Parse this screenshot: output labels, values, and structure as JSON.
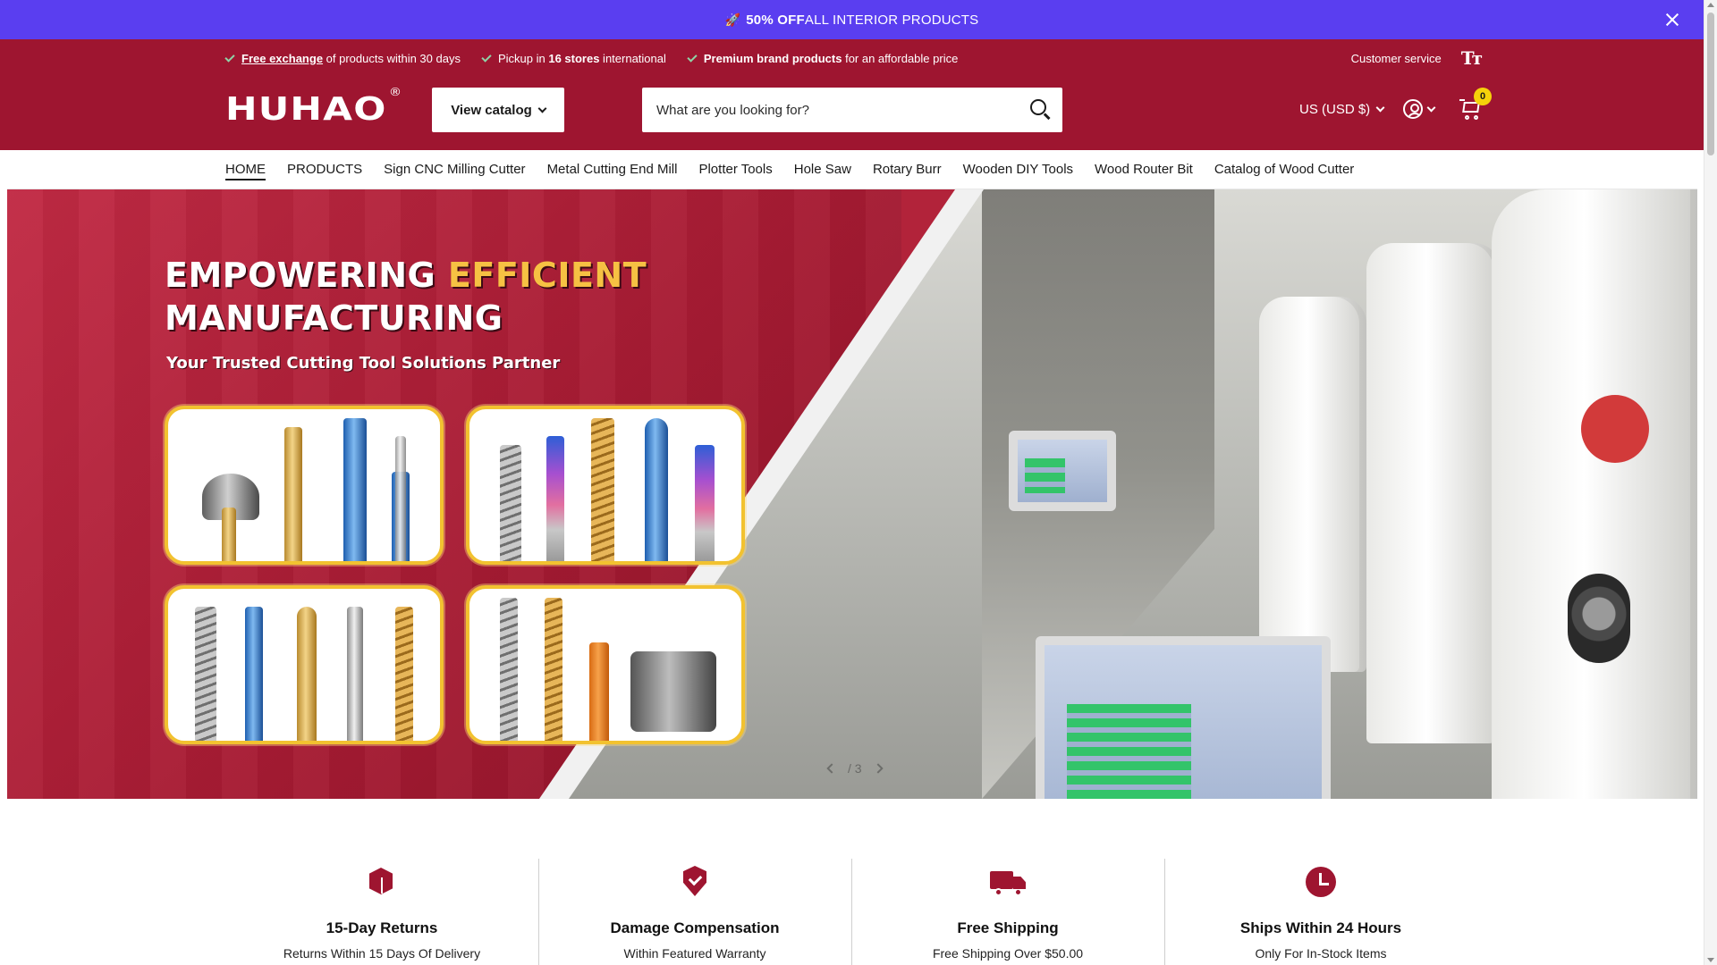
{
  "announcement": {
    "rocket": "🚀",
    "bold": "50% OFF",
    "text": " ALL INTERIOR PRODUCTS"
  },
  "usps": [
    {
      "link": "Free exchange",
      "rest": " of products within 30 days"
    },
    {
      "pre": "Pickup in ",
      "bold": "16 stores",
      "rest": " international"
    },
    {
      "bold": "Premium brand products",
      "rest": " for an affordable price"
    }
  ],
  "utility": {
    "customer_service": "Customer service",
    "text_size_icon": "Tт"
  },
  "brand": {
    "logo": "HUHAO",
    "registered": "®"
  },
  "header": {
    "view_catalog": "View catalog",
    "search_placeholder": "What are you looking for?",
    "currency": "US (USD $)",
    "cart_count": "0"
  },
  "nav": [
    "HOME",
    "PRODUCTS",
    "Sign CNC Milling Cutter",
    "Metal Cutting End Mill",
    "Plotter Tools",
    "Hole Saw",
    "Rotary Burr",
    "Wooden DIY Tools",
    "Wood Router Bit",
    "Catalog of Wood Cutter"
  ],
  "hero": {
    "headline_1": "EMPOWERING ",
    "headline_em": "EFFICIENT",
    "headline_2": "MANUFACTURING",
    "subheadline": "Your Trusted Cutting Tool Solutions Partner",
    "pager": "/ 3"
  },
  "features": [
    {
      "icon": "box-icon",
      "title": "15-Day Returns",
      "subtitle": "Returns Within 15 Days Of Delivery"
    },
    {
      "icon": "shield-check-icon",
      "title": "Damage Compensation",
      "subtitle": "Within Featured Warranty"
    },
    {
      "icon": "truck-icon",
      "title": "Free Shipping",
      "subtitle": "Free Shipping Over $50.00"
    },
    {
      "icon": "clock-icon",
      "title": "Ships Within 24 Hours",
      "subtitle": "Only For In-Stock Items"
    }
  ],
  "colors": {
    "announcement_bg": "#5a3ef0",
    "header_bg": "#9e1530",
    "cart_badge": "#f5d20a",
    "accent": "#9e1530"
  }
}
